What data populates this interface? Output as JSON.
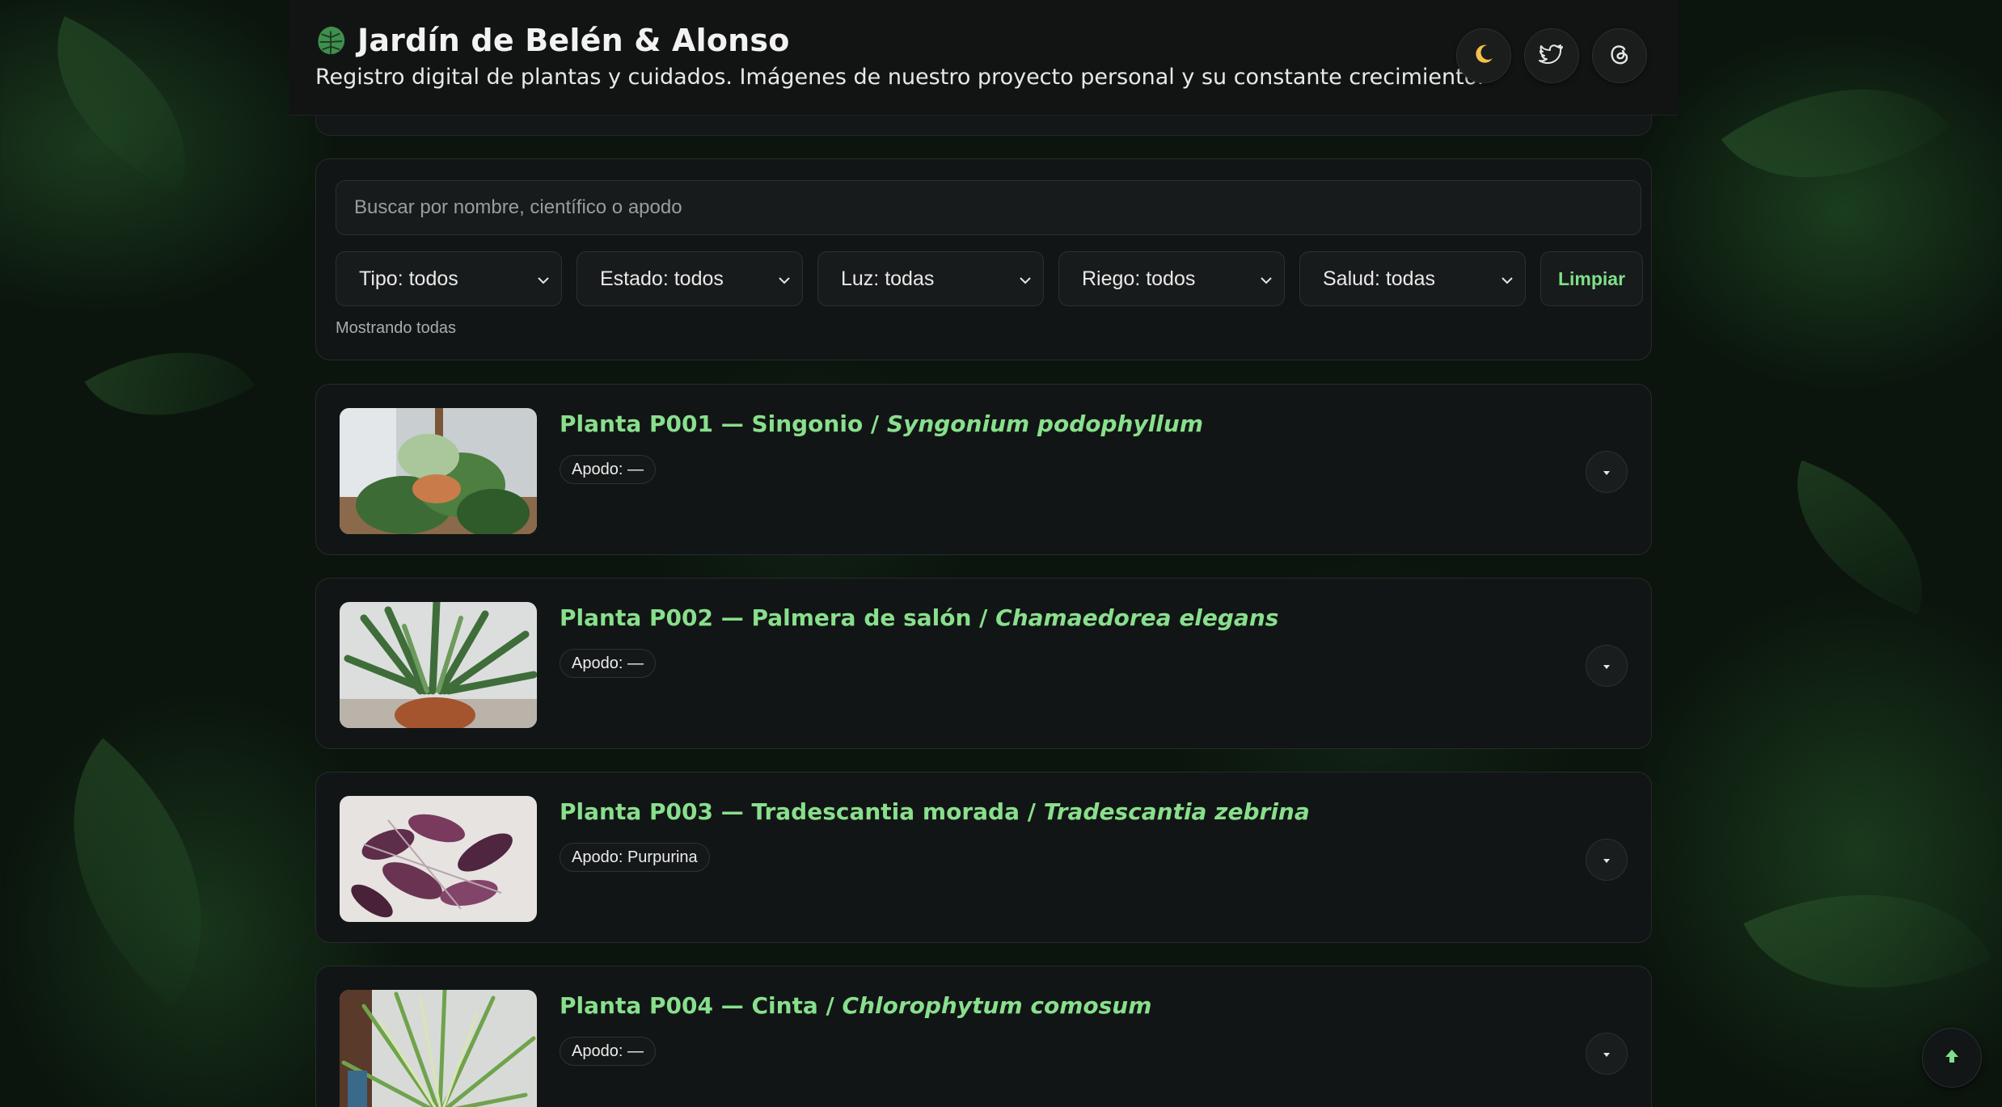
{
  "header": {
    "title": "Jardín de Belén & Alonso",
    "subtitle": "Registro digital de plantas y cuidados. Imágenes de nuestro proyecto personal y su constante crecimiento.",
    "actions": [
      {
        "icon": "moon-icon"
      },
      {
        "icon": "twitter-icon"
      },
      {
        "icon": "threads-icon"
      }
    ]
  },
  "filters": {
    "search_placeholder": "Buscar por nombre, científico o apodo",
    "selects": [
      {
        "label": "Tipo: todos"
      },
      {
        "label": "Estado: todos"
      },
      {
        "label": "Luz: todas"
      },
      {
        "label": "Riego: todos"
      },
      {
        "label": "Salud: todas"
      }
    ],
    "clear_label": "Limpiar",
    "status": "Mostrando todas"
  },
  "plants": [
    {
      "title_prefix": "Planta P001 — Singonio / ",
      "scientific": "Syngonium podophyllum",
      "nickname": "Apodo: —"
    },
    {
      "title_prefix": "Planta P002 — Palmera de salón / ",
      "scientific": "Chamaedorea elegans",
      "nickname": "Apodo: —"
    },
    {
      "title_prefix": "Planta P003 — Tradescantia morada / ",
      "scientific": "Tradescantia zebrina",
      "nickname": "Apodo: Purpurina"
    },
    {
      "title_prefix": "Planta P004 — Cinta / ",
      "scientific": "Chlorophytum comosum",
      "nickname": "Apodo: —"
    }
  ],
  "colors": {
    "accent": "#88df8c",
    "background": "#0b150d",
    "card": "#121515"
  },
  "scroll_top": {
    "icon": "arrow-up-icon"
  }
}
